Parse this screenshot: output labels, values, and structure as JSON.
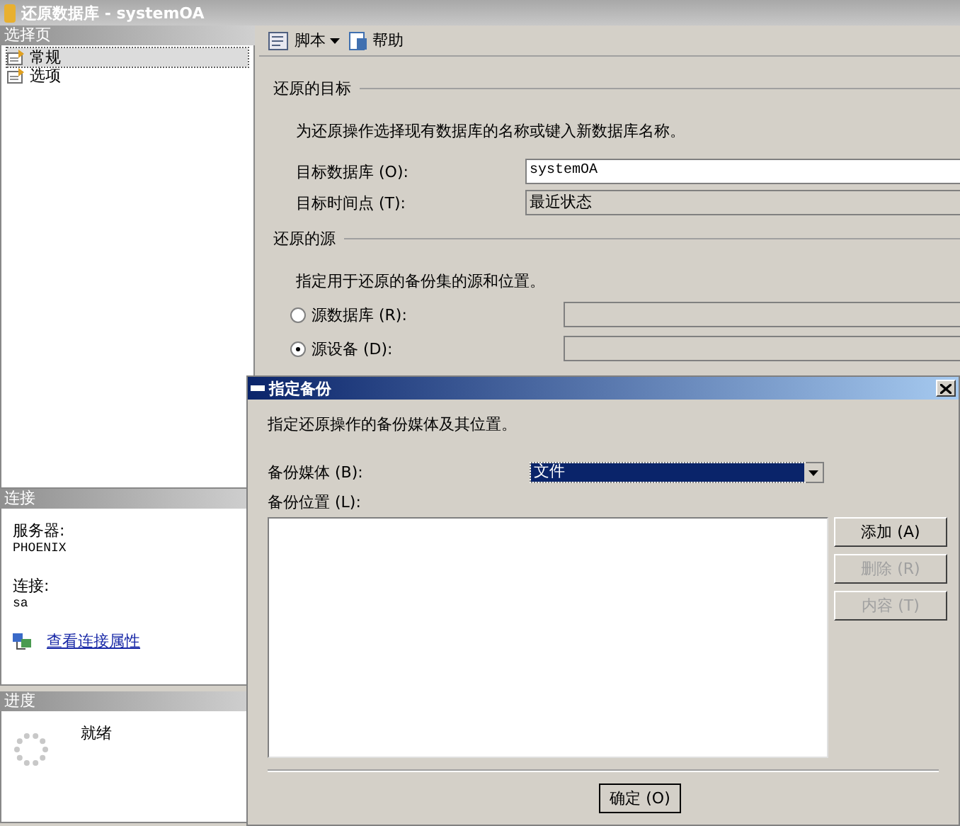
{
  "window": {
    "title": "还原数据库 - systemOA"
  },
  "sidebar": {
    "header": "选择页",
    "items": [
      {
        "label": "常规",
        "selected": true
      },
      {
        "label": "选项",
        "selected": false
      }
    ]
  },
  "connection": {
    "header": "连接",
    "server_label": "服务器:",
    "server": "PHOENIX",
    "login_label": "连接:",
    "login": "sa",
    "link": "查看连接属性"
  },
  "progress": {
    "header": "进度",
    "status": "就绪"
  },
  "toolbar": [
    {
      "label": "脚本",
      "dropdown": true
    },
    {
      "label": "帮助",
      "dropdown": false
    }
  ],
  "destination": {
    "heading": "还原的目标",
    "description": "为还原操作选择现有数据库的名称或键入新数据库名称。",
    "fields": [
      {
        "label": "目标数据库 (O):",
        "value": "systemOA",
        "disabled": false
      },
      {
        "label": "目标时间点 (T):",
        "value": "最近状态",
        "disabled": true
      }
    ]
  },
  "source": {
    "heading": "还原的源",
    "description": "指定用于还原的备份集的源和位置。",
    "options": [
      {
        "label": "源数据库 (R):",
        "selected": false
      },
      {
        "label": "源设备 (D):",
        "selected": true
      }
    ]
  },
  "dialog": {
    "title": "指定备份",
    "description": "指定还原操作的备份媒体及其位置。",
    "media_label": "备份媒体 (B):",
    "media_value": "文件",
    "location_label": "备份位置 (L):",
    "side_buttons": [
      {
        "label": "添加 (A)",
        "disabled": false
      },
      {
        "label": "删除 (R)",
        "disabled": true
      },
      {
        "label": "内容 (T)",
        "disabled": true
      }
    ],
    "buttons": [
      "确定 (O)"
    ]
  }
}
